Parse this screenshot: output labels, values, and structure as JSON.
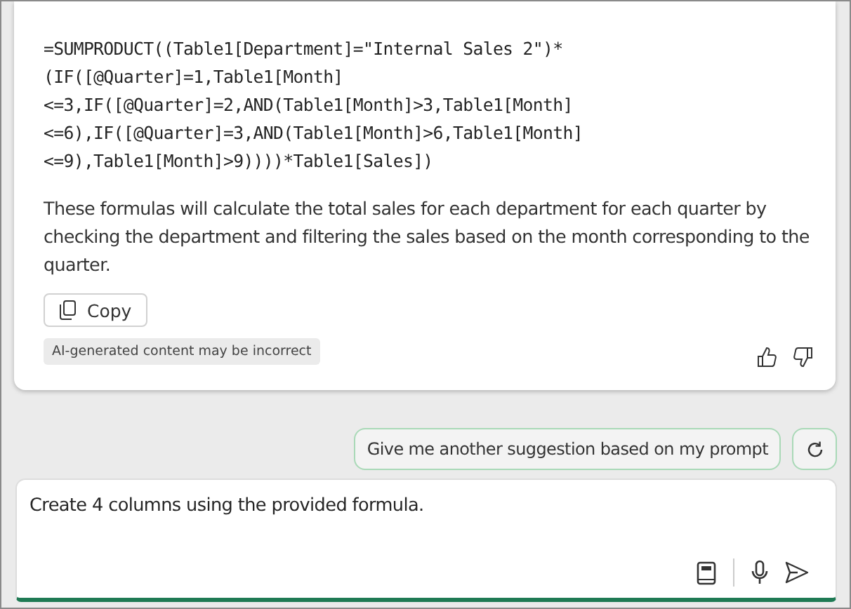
{
  "response": {
    "code_lines": [
      "=SUMPRODUCT((Table1[Department]=\"Internal Sales 2\")*",
      "(IF([@Quarter]=1,Table1[Month]",
      "<=3,IF([@Quarter]=2,AND(Table1[Month]>3,Table1[Month]",
      "<=6),IF([@Quarter]=3,AND(Table1[Month]>6,Table1[Month]",
      "<=9),Table1[Month]>9))))*Table1[Sales])"
    ],
    "paragraph": "These formulas will calculate the total sales for each department for each quarter by checking the department and filtering the sales based on the month corresponding to the quarter.",
    "copy_label": "Copy",
    "disclaimer": "AI-generated content may be incorrect"
  },
  "suggestion": "Give me another suggestion based on my prompt",
  "composer": {
    "value": "Create 4 columns using the provided formula."
  }
}
